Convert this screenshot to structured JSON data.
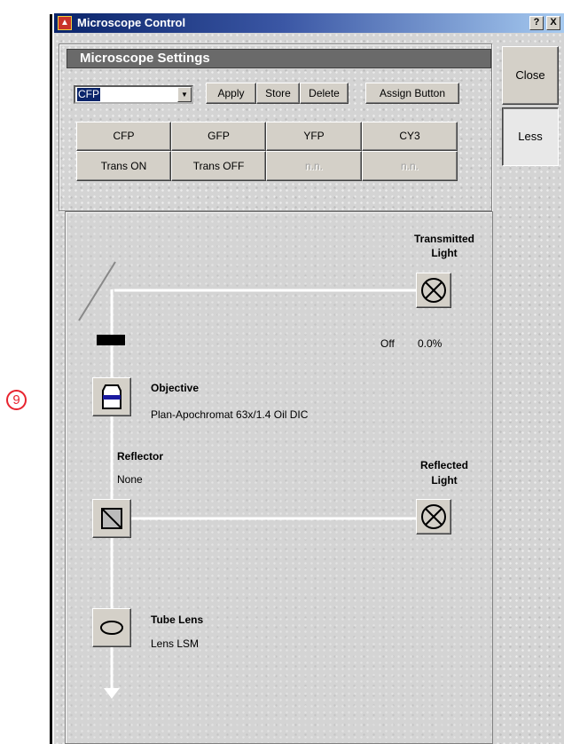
{
  "callout": "9",
  "window": {
    "title": "Microscope Control",
    "help_button": "?",
    "close_button": "X"
  },
  "side_buttons": {
    "close": "Close",
    "less": "Less"
  },
  "settings": {
    "header": "Microscope Settings",
    "selected_setting": "CFP",
    "apply": "Apply",
    "store": "Store",
    "delete": "Delete",
    "assign_button": "Assign Button",
    "presets": [
      {
        "label": "CFP",
        "enabled": true
      },
      {
        "label": "GFP",
        "enabled": true
      },
      {
        "label": "YFP",
        "enabled": true
      },
      {
        "label": "CY3",
        "enabled": true
      },
      {
        "label": "Trans ON",
        "enabled": true
      },
      {
        "label": "Trans OFF",
        "enabled": true
      },
      {
        "label": "n.n.",
        "enabled": false
      },
      {
        "label": "n.n.",
        "enabled": false
      }
    ]
  },
  "light_path": {
    "transmitted_light_title_1": "Transmitted",
    "transmitted_light_title_2": "Light",
    "transmitted_status": "Off",
    "transmitted_intensity": "0.0%",
    "objective_label": "Objective",
    "objective_value": "Plan-Apochromat 63x/1.4 Oil DIC",
    "reflector_label": "Reflector",
    "reflector_value": "None",
    "reflected_light_title_1": "Reflected",
    "reflected_light_title_2": "Light",
    "tube_lens_label": "Tube Lens",
    "tube_lens_value": "Lens LSM"
  }
}
